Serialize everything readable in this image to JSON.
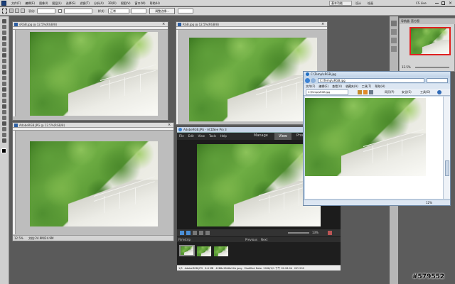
{
  "app": {
    "menu": [
      "文件(F)",
      "编辑(E)",
      "图像(I)",
      "图层(L)",
      "选择(S)",
      "滤镜(T)",
      "分析(A)",
      "3D(D)",
      "视图(V)",
      "窗口(W)",
      "帮助(H)"
    ],
    "workspace": "基本功能",
    "workspace_items": [
      "设计",
      "绘画"
    ],
    "cs_live": "CS Live"
  },
  "options": {
    "field1_label": "羽化:",
    "field2_label": "样式:",
    "field2_value": "正常",
    "refine_button": "调整边缘...",
    "width_label": "宽度:",
    "height_label": "高度:"
  },
  "panel": {
    "tabs": [
      "导航器",
      "直方图"
    ],
    "zoom": "12.5%"
  },
  "ps_docs": [
    {
      "title": "sRGB.jpg @ 12.5%(RGB/8)",
      "zoom": "12.5%",
      "status": "文档:24.9M/24.9M"
    },
    {
      "title": "RGB.jpg @ 12.5%(RGB/8)",
      "zoom": "12.5%",
      "status": "文档:24.9M/24.9M"
    },
    {
      "title": "AdobeRGB.JPG @ 12.5%(RGB/8)",
      "zoom": "12.5%",
      "status": "文档:24.9M/24.9M"
    }
  ],
  "acdsee": {
    "title": "AdobeRGB.JPG - ACDSee Pro 3",
    "menu": [
      "File",
      "Edit",
      "View",
      "Tools",
      "Help"
    ],
    "modes": [
      "Manage",
      "View",
      "Process"
    ],
    "zoom": "13%",
    "filmstrip_label": "Filmstrip",
    "prev_label": "Previous",
    "next_label": "Next",
    "status": [
      "1/3",
      "AdobeRGB.JPG",
      "6.6 MB",
      "4288x2848x24b jpeg",
      "Modified Date: 2008/1/1 下午 02:26:04",
      "ISO 200"
    ]
  },
  "ie": {
    "title": "C:\\Temp\\sRGB.jpg",
    "address": "C:\\Temp\\sRGB.jpg",
    "tab": "C:\\Temp\\sRGB.jpg",
    "menu": [
      "文件(F)",
      "编辑(E)",
      "查看(V)",
      "收藏夹(A)",
      "工具(T)",
      "帮助(H)"
    ],
    "toolbar": [
      "网页(P)",
      "安全(S)",
      "工具(O)"
    ],
    "zoom": "12%"
  },
  "watermark": "#579552"
}
